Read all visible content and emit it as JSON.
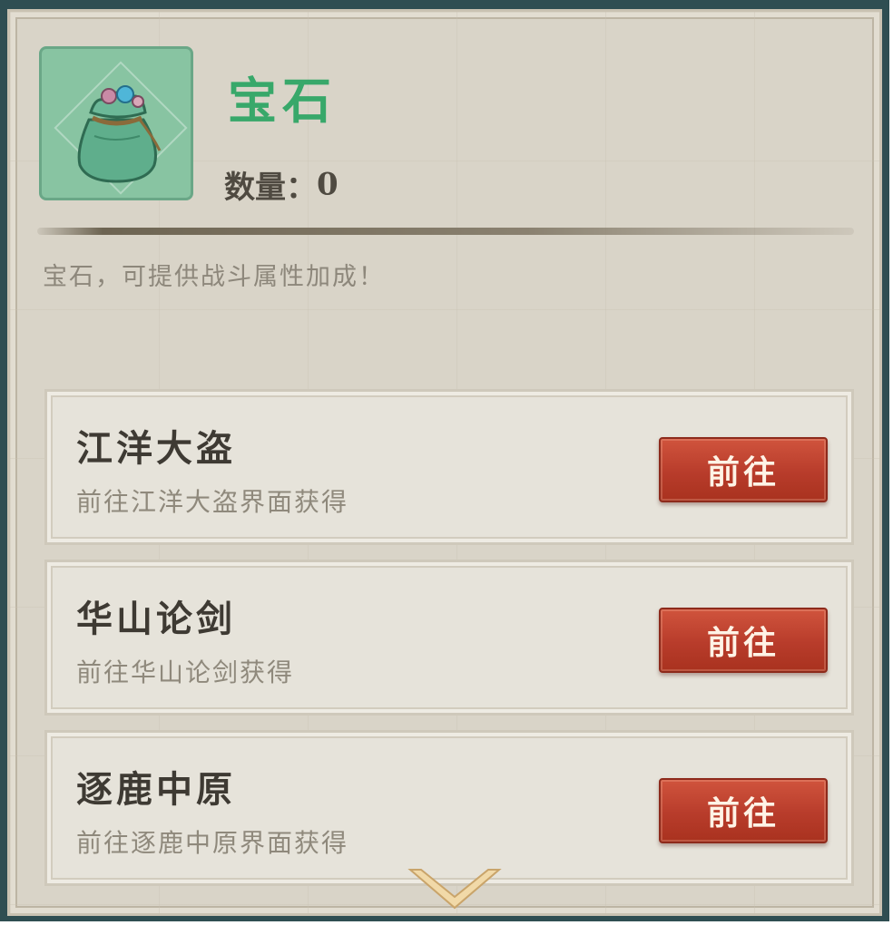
{
  "item": {
    "name": "宝石",
    "quantity_label": "数量：",
    "quantity": "0",
    "description": "宝石，可提供战斗属性加成！",
    "icon": "gem-bag-icon",
    "name_color": "#38a86a"
  },
  "sources": [
    {
      "title": "江洋大盗",
      "desc": "前往江洋大盗界面获得",
      "button": "前往"
    },
    {
      "title": "华山论剑",
      "desc": "前往华山论剑获得",
      "button": "前往"
    },
    {
      "title": "逐鹿中原",
      "desc": "前往逐鹿中原界面获得",
      "button": "前往"
    }
  ],
  "scroll": {
    "icon": "chevron-down-icon"
  },
  "colors": {
    "frame": "#2f4e52",
    "panel": "#d9d4c8",
    "button": "#b83c2b",
    "icon_bg": "#88c4a2"
  }
}
